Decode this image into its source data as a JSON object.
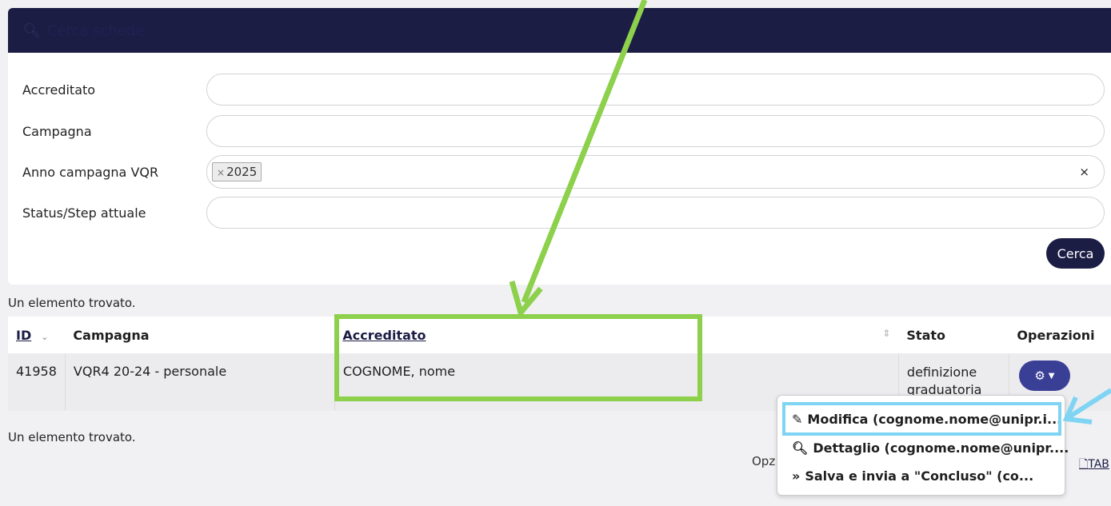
{
  "search_card": {
    "title": "Cerca schede",
    "fields": [
      {
        "label": "Accreditato",
        "value": ""
      },
      {
        "label": "Campagna",
        "value": ""
      },
      {
        "label": "Anno campagna VQR",
        "chip": "2025",
        "chip_remove": "×",
        "clear": "×"
      },
      {
        "label": "Status/Step attuale",
        "value": ""
      }
    ],
    "search_button": "Cerca"
  },
  "result_count_top": "Un elemento trovato.",
  "result_count_bottom": "Un elemento trovato.",
  "table": {
    "headers": [
      "ID",
      "Campagna",
      "Accreditato",
      "Stato",
      "Operazioni"
    ],
    "rows": [
      {
        "id": "41958",
        "campagna": "VQR4 20-24 - personale",
        "accreditato": "COGNOME, nome",
        "stato": "definizione graduatoria"
      }
    ]
  },
  "actions_menu": [
    {
      "icon": "pencil-icon",
      "label": "Modifica (cognome.nome@unipr.i..."
    },
    {
      "icon": "zoom-in-icon",
      "label": "Dettaglio (cognome.nome@unipr...."
    },
    {
      "icon": "double-chevron-right-icon",
      "label": "Salva e invia a \"Concluso\" (co..."
    }
  ],
  "footer": {
    "options_partial": "Opz",
    "tab_link_partial": "TAB"
  },
  "colors": {
    "navy": "#1c1d45",
    "button_blue": "#3a3f96",
    "annotation_green": "#8dd04c",
    "annotation_blue": "#7fd4f3"
  }
}
